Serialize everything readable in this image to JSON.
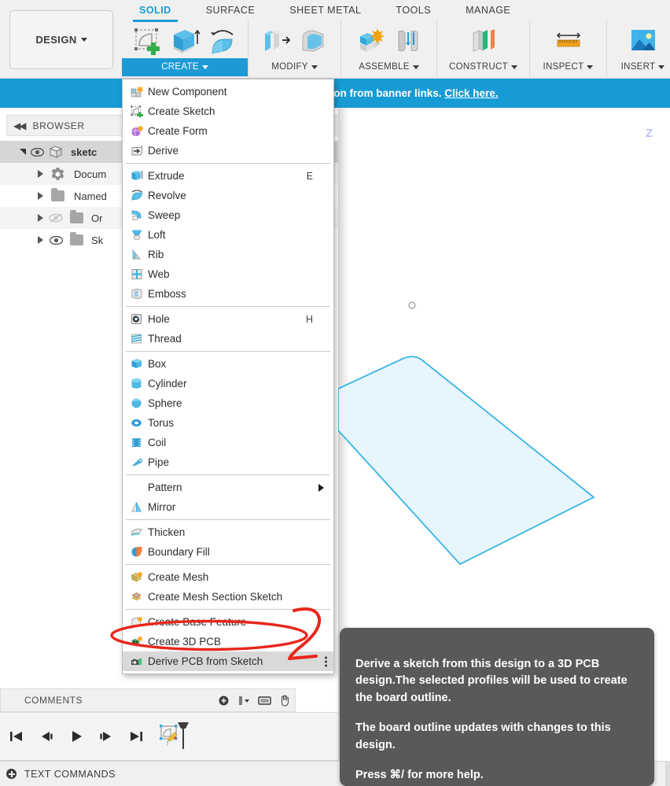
{
  "app": {
    "workspace_button": "DESIGN",
    "tabs": [
      {
        "label": "SOLID",
        "active": true
      },
      {
        "label": "SURFACE",
        "active": false
      },
      {
        "label": "SHEET METAL",
        "active": false
      },
      {
        "label": "TOOLS",
        "active": false
      },
      {
        "label": "MANAGE",
        "active": false
      }
    ],
    "panels": [
      {
        "label": "CREATE",
        "selected": true,
        "icons": [
          "create-sketch-icon",
          "extrude-icon",
          "revolve-icon"
        ]
      },
      {
        "label": "MODIFY",
        "selected": false,
        "icons": [
          "press-pull-icon",
          "fillet-icon"
        ]
      },
      {
        "label": "ASSEMBLE",
        "selected": false,
        "icons": [
          "new-component-icon",
          "joint-icon"
        ]
      },
      {
        "label": "CONSTRUCT",
        "selected": false,
        "icons": [
          "offset-plane-icon"
        ]
      },
      {
        "label": "INSPECT",
        "selected": false,
        "icons": [
          "measure-icon"
        ]
      },
      {
        "label": "INSERT",
        "selected": false,
        "icons": [
          "decal-icon"
        ]
      }
    ]
  },
  "banner": {
    "text": "tion from banner links.",
    "link": "Click here.",
    "color": "#169bd5"
  },
  "browser": {
    "title": "BROWSER",
    "collapse_glyph": "◀◀",
    "tree": [
      {
        "label": "sketc",
        "indent": 0,
        "expanded": true,
        "eye": true,
        "selected": true,
        "icon": "component-icon"
      },
      {
        "label": "Docum",
        "indent": 1,
        "expanded": false,
        "eye": false,
        "selected": false,
        "icon": "gear-icon"
      },
      {
        "label": "Named",
        "indent": 1,
        "expanded": false,
        "eye": false,
        "selected": false,
        "icon": "folder-icon"
      },
      {
        "label": "Or",
        "indent": 1,
        "expanded": false,
        "eye": "off",
        "selected": false,
        "icon": "folder-icon"
      },
      {
        "label": "Sk",
        "indent": 1,
        "expanded": false,
        "eye": true,
        "selected": false,
        "icon": "folder-icon"
      }
    ]
  },
  "viewport": {
    "axis_label": "Z",
    "sketch_fill": "#e6f6fc",
    "sketch_stroke": "#39b4e6"
  },
  "menu": {
    "items": [
      {
        "label": "New Component",
        "icon": "new-component-icon",
        "key": "",
        "sep_after": false
      },
      {
        "label": "Create Sketch",
        "icon": "create-sketch-icon",
        "key": "",
        "sep_after": false
      },
      {
        "label": "Create Form",
        "icon": "create-form-icon",
        "key": "",
        "sep_after": false
      },
      {
        "label": "Derive",
        "icon": "derive-icon",
        "key": "",
        "sep_after": true
      },
      {
        "label": "Extrude",
        "icon": "extrude-icon",
        "key": "E",
        "sep_after": false
      },
      {
        "label": "Revolve",
        "icon": "revolve-icon",
        "key": "",
        "sep_after": false
      },
      {
        "label": "Sweep",
        "icon": "sweep-icon",
        "key": "",
        "sep_after": false
      },
      {
        "label": "Loft",
        "icon": "loft-icon",
        "key": "",
        "sep_after": false
      },
      {
        "label": "Rib",
        "icon": "rib-icon",
        "key": "",
        "sep_after": false
      },
      {
        "label": "Web",
        "icon": "web-icon",
        "key": "",
        "sep_after": false
      },
      {
        "label": "Emboss",
        "icon": "emboss-icon",
        "key": "",
        "sep_after": true
      },
      {
        "label": "Hole",
        "icon": "hole-icon",
        "key": "H",
        "sep_after": false
      },
      {
        "label": "Thread",
        "icon": "thread-icon",
        "key": "",
        "sep_after": true
      },
      {
        "label": "Box",
        "icon": "box-icon",
        "key": "",
        "sep_after": false
      },
      {
        "label": "Cylinder",
        "icon": "cylinder-icon",
        "key": "",
        "sep_after": false
      },
      {
        "label": "Sphere",
        "icon": "sphere-icon",
        "key": "",
        "sep_after": false
      },
      {
        "label": "Torus",
        "icon": "torus-icon",
        "key": "",
        "sep_after": false
      },
      {
        "label": "Coil",
        "icon": "coil-icon",
        "key": "",
        "sep_after": false
      },
      {
        "label": "Pipe",
        "icon": "pipe-icon",
        "key": "",
        "sep_after": true
      },
      {
        "label": "Pattern",
        "icon": "none",
        "key": "",
        "submenu": true,
        "sep_after": false
      },
      {
        "label": "Mirror",
        "icon": "mirror-icon",
        "key": "",
        "sep_after": true
      },
      {
        "label": "Thicken",
        "icon": "thicken-icon",
        "key": "",
        "sep_after": false
      },
      {
        "label": "Boundary Fill",
        "icon": "boundary-fill-icon",
        "key": "",
        "sep_after": true
      },
      {
        "label": "Create Mesh",
        "icon": "create-mesh-icon",
        "key": "",
        "sep_after": false
      },
      {
        "label": "Create Mesh Section Sketch",
        "icon": "mesh-section-sketch-icon",
        "key": "",
        "sep_after": true
      },
      {
        "label": "Create Base Feature",
        "icon": "create-base-feature-icon",
        "key": "",
        "sep_after": false
      },
      {
        "label": "Create 3D PCB",
        "icon": "create-3d-pcb-icon",
        "key": "",
        "sep_after": false
      },
      {
        "label": "Derive PCB from Sketch",
        "icon": "derive-pcb-icon",
        "key": "",
        "highlighted": true,
        "overflow_dots": true,
        "sep_after": false
      }
    ]
  },
  "annotation": {
    "number": "2",
    "color": "#e8261c",
    "shape": "ellipse-around-derive-pcb-from-sketch"
  },
  "tooltip": {
    "paragraphs": [
      "Derive a sketch from this design to a 3D PCB design.The selected profiles will be used to create the board outline.",
      "The board outline updates with changes to this design.",
      "Press ⌘/ for more help."
    ]
  },
  "bottom": {
    "comments_label": "COMMENTS",
    "comments_buttons": [
      "add-comment-icon",
      "display-settings-icon",
      "grid-settings-icon",
      "pan-icon"
    ],
    "timeline_buttons": [
      "go-to-beginning-icon",
      "step-back-icon",
      "play-icon",
      "step-forward-icon",
      "go-to-end-icon"
    ],
    "timeline_features": [
      "sketch-feature-icon"
    ],
    "text_commands_label": "TEXT COMMANDS"
  }
}
